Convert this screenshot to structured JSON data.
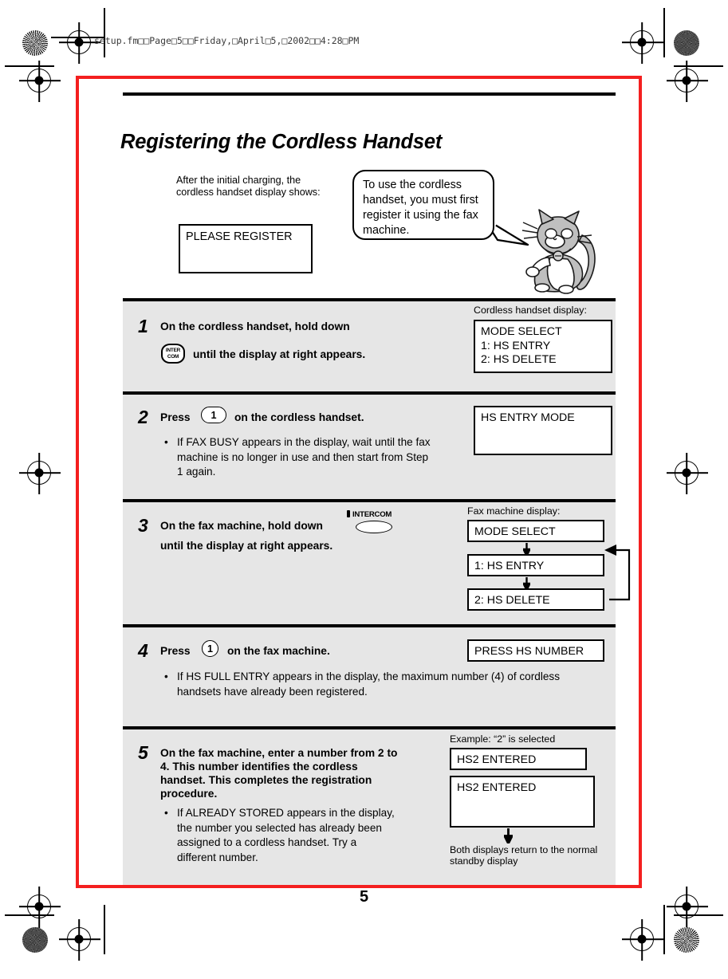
{
  "print_header": {
    "filename_line": "setup.fm□□Page□5□□Friday,□April□5,□2002□□4:28□PM"
  },
  "page": {
    "title": "Registering the Cordless Handset",
    "page_number": "5",
    "frame_color": "#f41f1f",
    "band_color": "#e6e6e6"
  },
  "intro": {
    "note": "After the initial charging, the cordless handset display shows:",
    "handset_display": "PLEASE REGISTER",
    "bubble_text": "To use the cordless handset, you must first register it using the fax machine.",
    "mascot_icon": "cat-mascot-icon"
  },
  "steps": [
    {
      "number": "1",
      "line1": "On the cordless handset, hold down",
      "line2": "until the display at right appears.",
      "key_icon": "intercom-key-icon",
      "key_label_top": "INTER",
      "key_label_bottom": "COM",
      "side_label": "Cordless handset display:",
      "display_lines": [
        "MODE SELECT",
        "1: HS ENTRY",
        "2: HS DELETE"
      ]
    },
    {
      "number": "2",
      "text_before_key": "Press",
      "key_label": "1",
      "key_icon": "handset-key-1-icon",
      "text_after_key": "on the cordless handset.",
      "bullets": [
        "If FAX BUSY appears in the display, wait until the fax machine is no longer in use and then start from Step 1 again."
      ],
      "display_lines": [
        "HS ENTRY MODE"
      ]
    },
    {
      "number": "3",
      "line1": "On the fax machine, hold down",
      "line2": "until the display at right appears.",
      "key_icon": "fax-intercom-button-icon",
      "key_label": "INTERCOM",
      "side_label": "Fax machine display:",
      "flow_boxes": [
        "MODE SELECT",
        "1: HS ENTRY",
        "2: HS DELETE"
      ],
      "flow_loop_icon": "loop-back-arrow-icon"
    },
    {
      "number": "4",
      "text_before_key": "Press",
      "key_label": "1",
      "key_icon": "fax-key-1-icon",
      "text_after_key": "on the fax machine.",
      "bullets": [
        "If HS FULL ENTRY appears in the display, the maximum number (4) of cordless handsets have already been registered."
      ],
      "display_lines": [
        "PRESS HS NUMBER"
      ]
    },
    {
      "number": "5",
      "text": "On the fax machine, enter a number from 2 to 4. This number identifies the cordless handset. This completes the registration procedure.",
      "bullets": [
        "If ALREADY STORED appears in the display, the number you selected has already been assigned to a cordless handset. Try a different number."
      ],
      "side_label": "Example: “2” is selected",
      "display_small": "HS2 ENTERED",
      "display_large": "HS2 ENTERED",
      "footnote": "Both displays return to the normal standby display",
      "arrow_icon": "down-arrow-icon"
    }
  ]
}
